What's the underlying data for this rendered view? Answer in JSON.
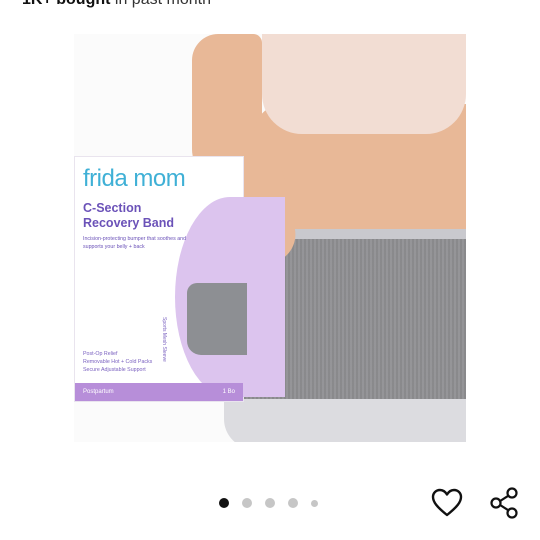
{
  "banner": {
    "count": "1K+",
    "bought": "bought",
    "period": "in past month"
  },
  "product": {
    "box": {
      "brand": "frida mom",
      "title": "C-Section Recovery Band",
      "description": "Incision-protecting bumper that soothes and supports your belly + back",
      "vertical_label": "Sports Mesh Sleeve",
      "features": [
        "Post-Op Relief",
        "Removable Hot + Cold Packs",
        "Secure Adjustable Support"
      ],
      "footer_left": "Postpartum",
      "footer_right": "1 Bo"
    }
  },
  "carousel": {
    "dot_count": 5,
    "active_index": 0
  },
  "actions": {
    "favorite_icon": "heart-icon",
    "share_icon": "share-icon"
  },
  "colors": {
    "brand": "#3fb0d6",
    "box_text": "#6b52b8",
    "box_accent": "#b78ed9"
  }
}
